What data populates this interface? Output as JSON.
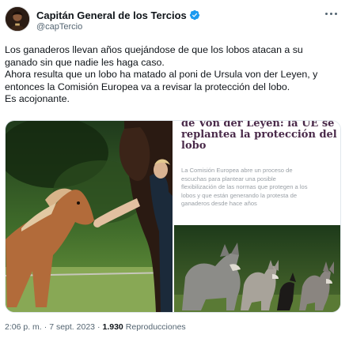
{
  "author": {
    "display_name": "Capitán General de los Tercios",
    "handle": "@capTercio",
    "verified": true,
    "avatar_icon": "avatar-portrait"
  },
  "tweet": {
    "lines": [
      "Los ganaderos llevan años quejándose de que los lobos atacan a su",
      "ganado sin que nadie les haga caso.",
      "Ahora resulta que un lobo ha matado al poni de Ursula von der Leyen, y",
      "entonces la Comisión Europea va a revisar la protección del lobo.",
      "Es acojonante."
    ]
  },
  "media": {
    "article": {
      "headline_lines": [
        "de Von der Leyen: la UE se",
        "replantea la protección del",
        "lobo"
      ],
      "lead_lines": [
        "La Comisión Europea abre un proceso de",
        "escuchas para plantear una posible",
        "flexibilización de las normas que protegen a los",
        "lobos y que están generando la protesta de",
        "ganaderos desde hace años"
      ]
    }
  },
  "meta": {
    "time": "2:06 p. m.",
    "separator": "·",
    "date": "7 sept. 2023",
    "views_count": "1.930",
    "views_label": "Reproducciones"
  },
  "colors": {
    "verified": "#1d9bf0",
    "headline": "#4a2a4a",
    "secondary_text": "#536471"
  }
}
